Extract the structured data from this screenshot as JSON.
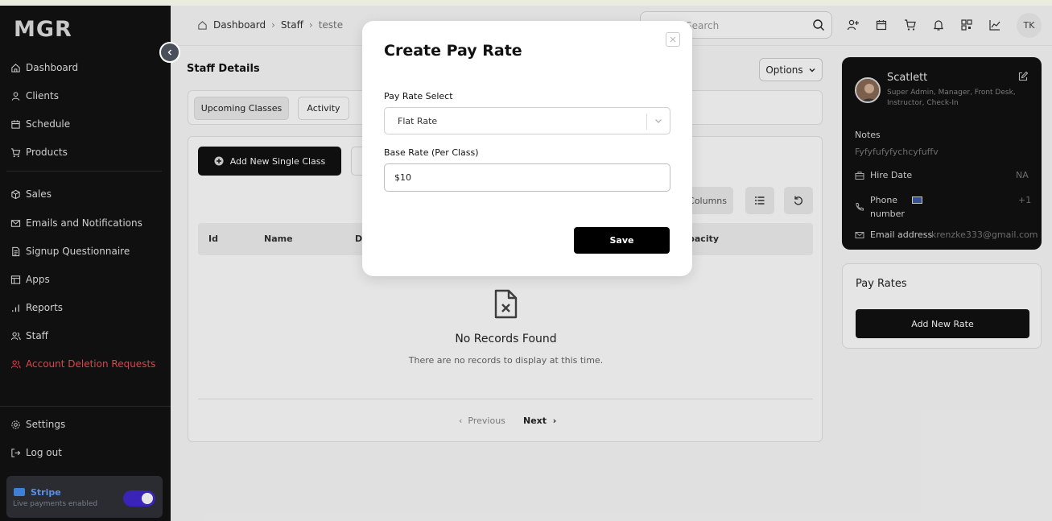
{
  "app": {
    "logo": "MGR"
  },
  "sidebar": {
    "items": [
      {
        "label": "Dashboard",
        "icon": "home-icon"
      },
      {
        "label": "Clients",
        "icon": "user-icon"
      },
      {
        "label": "Schedule",
        "icon": "calendar-icon"
      },
      {
        "label": "Products",
        "icon": "cart-icon"
      },
      {
        "label": "Sales",
        "icon": "package-icon"
      },
      {
        "label": "Emails and Notifications",
        "icon": "mail-icon"
      },
      {
        "label": "Signup Questionnaire",
        "icon": "document-icon"
      },
      {
        "label": "Apps",
        "icon": "window-icon"
      },
      {
        "label": "Reports",
        "icon": "bars-icon"
      },
      {
        "label": "Staff",
        "icon": "users-icon"
      },
      {
        "label": "Account Deletion Requests",
        "icon": "users-icon"
      }
    ],
    "bottom": [
      {
        "label": "Settings",
        "icon": "gear-icon"
      },
      {
        "label": "Log out",
        "icon": "logout-icon"
      }
    ],
    "stripe": {
      "title": "Stripe",
      "subtitle": "Live payments enabled",
      "enabled": true
    }
  },
  "header": {
    "breadcrumb": [
      "Dashboard",
      "Staff",
      "teste"
    ],
    "search_placeholder": "Search",
    "avatar_initials": "TK"
  },
  "page": {
    "title": "Staff Details",
    "options_label": "Options",
    "tabs": [
      "Upcoming Classes",
      "Activity"
    ],
    "add_class_label": "Add New Single Class",
    "columns_label": "Columns",
    "table_headers": [
      "Id",
      "Name",
      "Da",
      "pacity"
    ],
    "empty_title": "No Records Found",
    "empty_subtitle": "There are no records to display at this time.",
    "pagination": {
      "previous": "Previous",
      "next": "Next"
    }
  },
  "profile": {
    "name": "Scatlett",
    "roles": "Super Admin, Manager, Front Desk, Instructor, Check-In",
    "notes_label": "Notes",
    "notes_value": "Fyfyfufyfychcyfuffv",
    "hire_date_label": "Hire Date",
    "hire_date_value": "NA",
    "phone_label": "Phone number",
    "phone_value": "+1",
    "email_label": "Email address",
    "email_value": "krenzke333@gmail.com"
  },
  "pay_rates": {
    "title": "Pay Rates",
    "add_label": "Add New Rate"
  },
  "modal": {
    "title": "Create Pay Rate",
    "select_label": "Pay Rate Select",
    "select_value": "Flat Rate",
    "base_rate_label": "Base Rate (Per Class)",
    "base_rate_value": "$10",
    "save_label": "Save"
  },
  "colors": {
    "accent": "#111111",
    "danger": "#e0434a",
    "stripe": "#5c8fe8",
    "toggle": "#3a23b8"
  }
}
